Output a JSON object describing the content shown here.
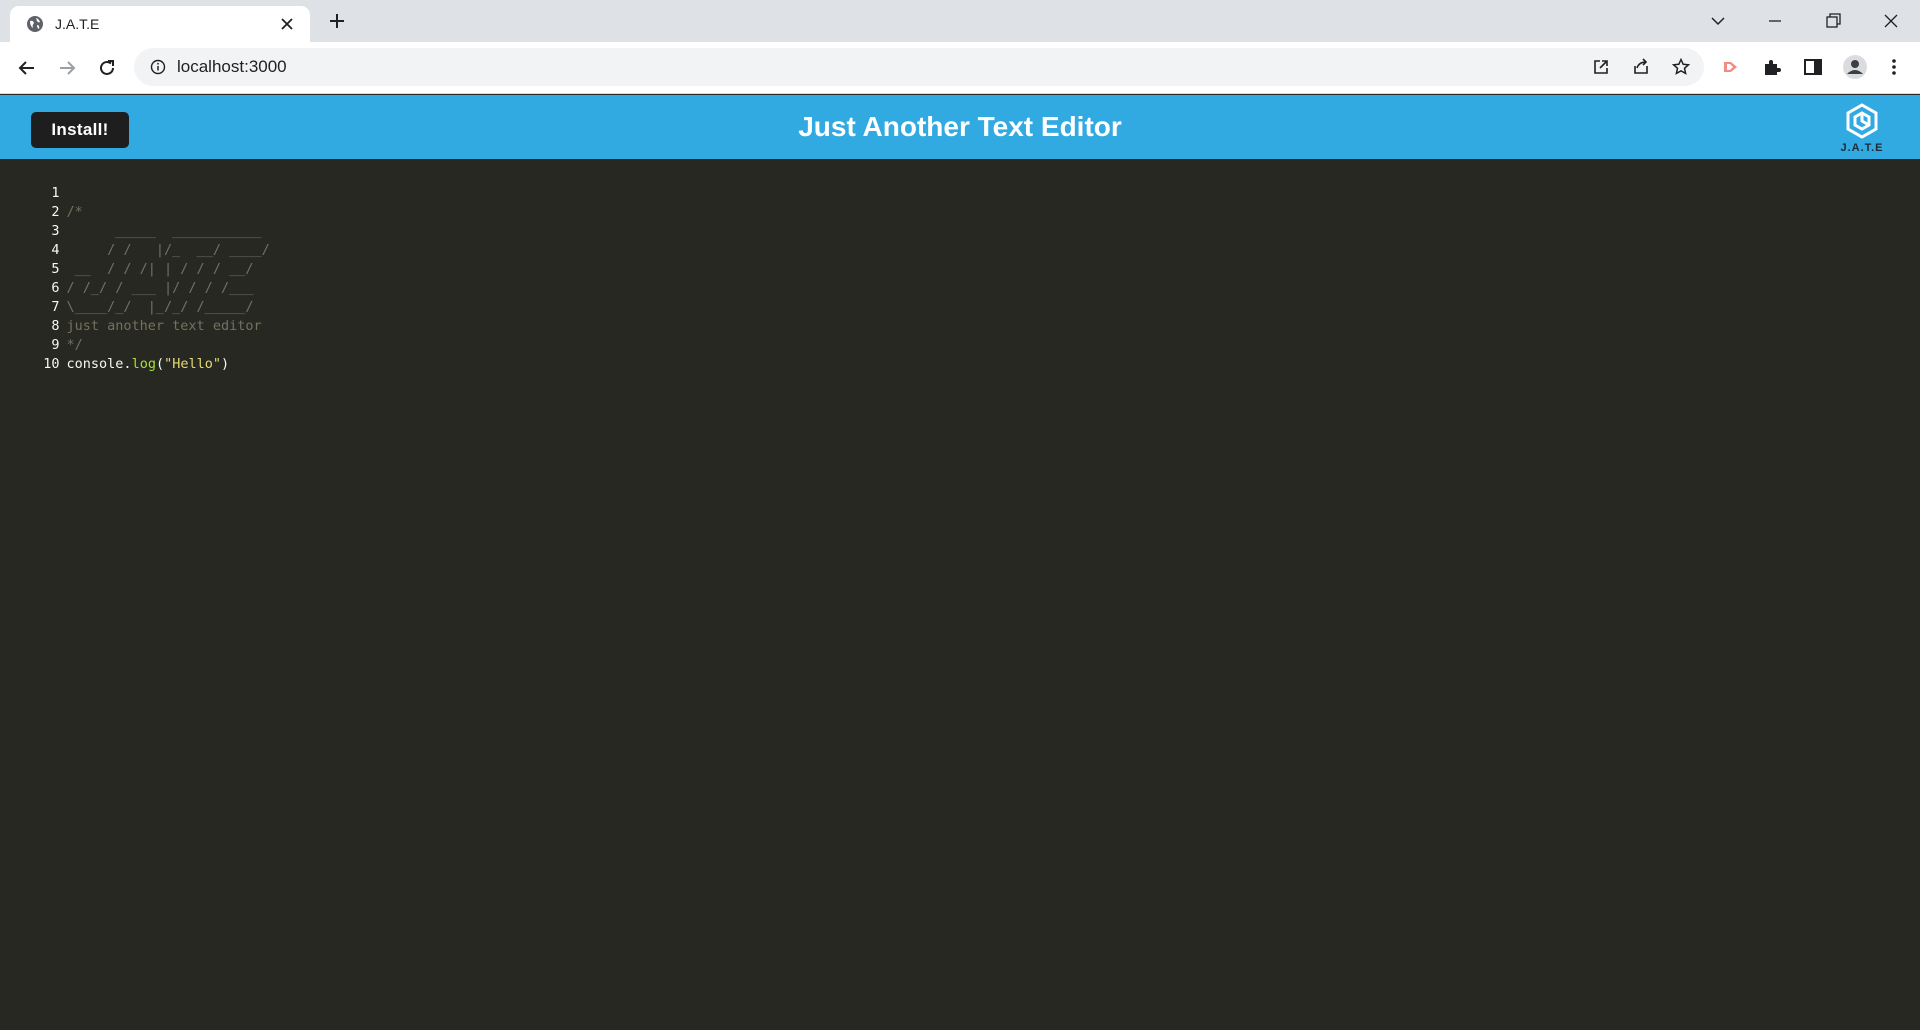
{
  "browser": {
    "tab_title": "J.A.T.E",
    "url": "localhost:3000"
  },
  "app": {
    "install_label": "Install!",
    "title": "Just Another Text Editor",
    "logo_text": "J.A.T.E",
    "header_color": "#31a9e1"
  },
  "editor": {
    "lines": [
      {
        "num": "1",
        "text": ""
      },
      {
        "num": "2",
        "text": "/*"
      },
      {
        "num": "3",
        "text": "      _____  ___________"
      },
      {
        "num": "4",
        "text": "     / /   |/_  __/ ____/"
      },
      {
        "num": "5",
        "text": " __  / / /| | / / / __/"
      },
      {
        "num": "6",
        "text": "/ /_/ / ___ |/ / / /___"
      },
      {
        "num": "7",
        "text": "\\____/_/  |_/_/ /_____/"
      },
      {
        "num": "8",
        "text": "just another text editor"
      },
      {
        "num": "9",
        "text": "*/"
      },
      {
        "num": "10",
        "text": ""
      }
    ],
    "code_line": {
      "object": "console",
      "dot": ".",
      "method": "log",
      "open": "(",
      "string": "\"Hello\"",
      "close": ")"
    }
  }
}
